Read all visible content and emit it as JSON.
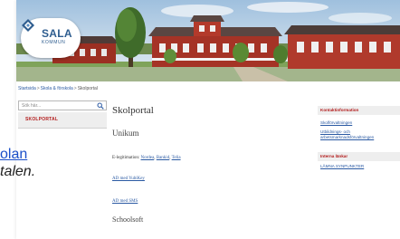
{
  "banner": {
    "logo": {
      "name": "SALA",
      "sub": "KOMMUN"
    }
  },
  "breadcrumb": {
    "items": [
      "Startsida",
      "Skola & förskola",
      "Skolportal"
    ],
    "separator": ">"
  },
  "search": {
    "placeholder": "Sök här..."
  },
  "leftnav": {
    "items": [
      {
        "label": "SKOLPORTAL"
      }
    ]
  },
  "overlay": {
    "link_text": "olan",
    "italic_text": "talen."
  },
  "main": {
    "title": "Skolportal",
    "section1": "Unikum",
    "elegitimation": {
      "label": "E-legitimation:",
      "links": [
        "Nordea",
        "Bankid",
        "Telia"
      ],
      "sep": ", "
    },
    "links": [
      "AD med YubiKey",
      "AD med SMS"
    ],
    "section2": "Schoolsoft"
  },
  "right": {
    "box1": {
      "title": "Kontaktinformation",
      "links": [
        "Skolförvaltningen",
        "Utbildnings- och arbetsmarknadsförvaltningen"
      ]
    },
    "box2": {
      "title": "Interna länkar",
      "links": [
        "LÄMNA SYNPUNKTER"
      ]
    }
  },
  "colors": {
    "accent_red": "#b31d1d",
    "link_blue": "#2b5aa3",
    "logo_blue": "#2e5d8f"
  },
  "icons": [
    "sala-logo-icon",
    "search-icon"
  ]
}
